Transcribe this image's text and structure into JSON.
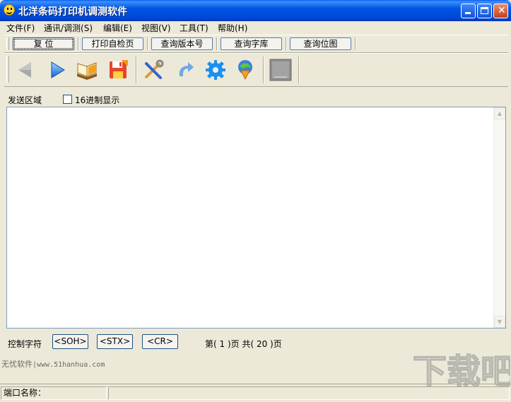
{
  "window": {
    "title": "北洋条码打印机调测软件"
  },
  "menu": [
    {
      "label": "文件(F)"
    },
    {
      "label": "通讯/调测(S)"
    },
    {
      "label": "编辑(E)"
    },
    {
      "label": "视图(V)"
    },
    {
      "label": "工具(T)"
    },
    {
      "label": "帮助(H)"
    }
  ],
  "commands": {
    "reset": "复  位",
    "self_test": "打印自检页",
    "query_version": "查询版本号",
    "query_font": "查询字库",
    "query_bitmap": "查询位图"
  },
  "toolbar_icons": [
    "back-arrow-icon",
    "forward-arrow-icon",
    "open-book-icon",
    "save-disk-icon",
    "tools-icon",
    "refresh-icon",
    "gear-icon",
    "download-icon",
    "grayed-panel-icon"
  ],
  "send_area": {
    "label": "发送区域",
    "hex_label": "16进制显示",
    "hex_checked": false,
    "content": ""
  },
  "control": {
    "label": "控制字符",
    "soh": "<SOH>",
    "stx": "<STX>",
    "cr": "<CR>",
    "page_info": "第( 1 )页  共( 20 )页"
  },
  "watermark": {
    "left_brand": "无忧软件",
    "left_url": "|www.51hanhua.com",
    "right_brand": "下载吧"
  },
  "status": {
    "port_label": "端口名称："
  }
}
